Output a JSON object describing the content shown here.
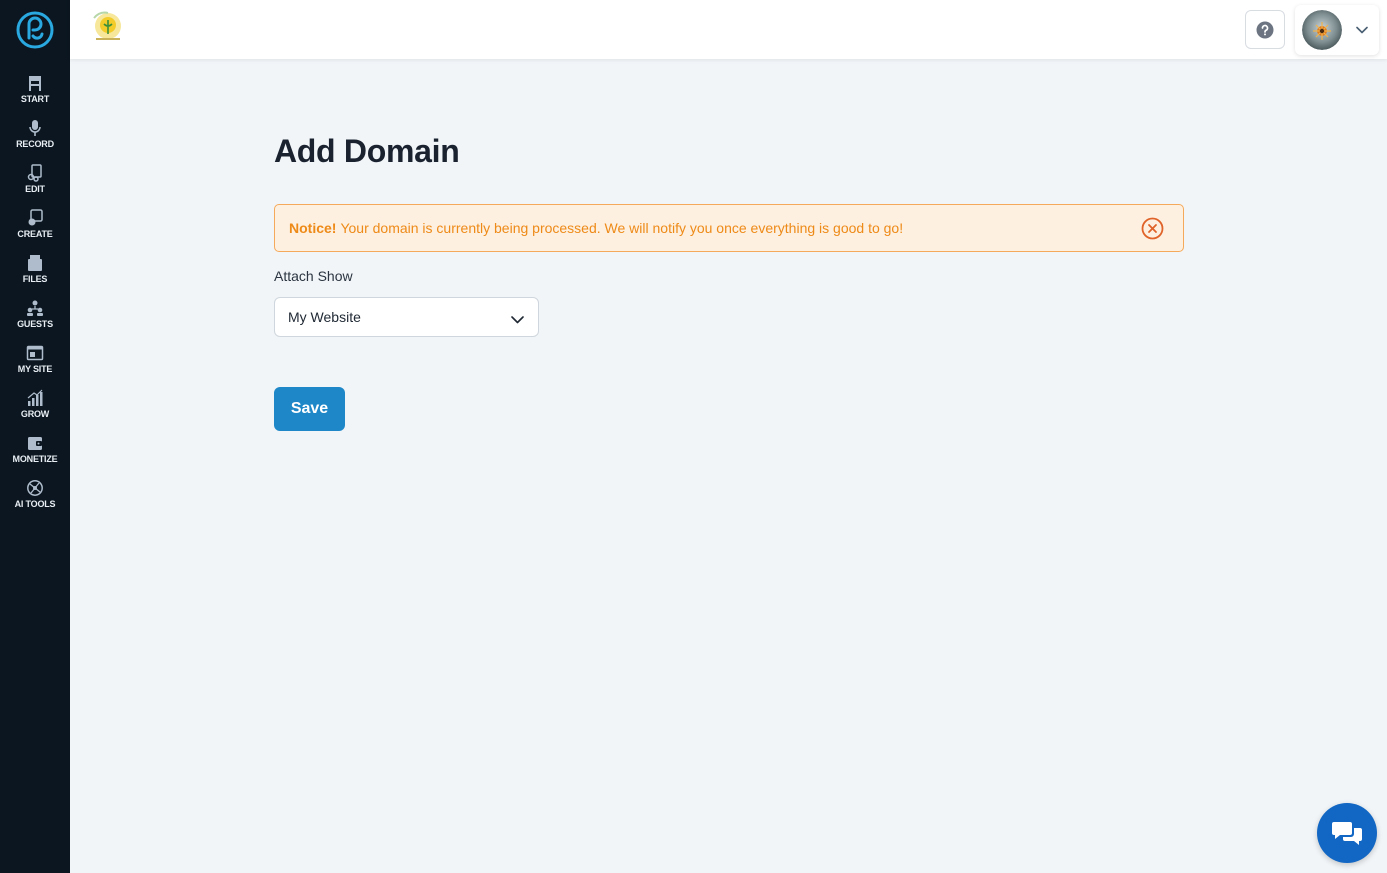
{
  "sidebar": {
    "items": [
      {
        "label": "START",
        "icon": "start-icon"
      },
      {
        "label": "RECORD",
        "icon": "microphone-icon"
      },
      {
        "label": "EDIT",
        "icon": "edit-icon"
      },
      {
        "label": "CREATE",
        "icon": "create-icon"
      },
      {
        "label": "FILES",
        "icon": "files-icon"
      },
      {
        "label": "GUESTS",
        "icon": "guests-icon"
      },
      {
        "label": "MY SITE",
        "icon": "my-site-icon"
      },
      {
        "label": "GROW",
        "icon": "grow-icon"
      },
      {
        "label": "MONETIZE",
        "icon": "monetize-icon"
      },
      {
        "label": "AI TOOLS",
        "icon": "ai-tools-icon"
      }
    ]
  },
  "header": {
    "help_icon": "question-circle-icon",
    "profile_chevron": "chevron-down-icon"
  },
  "main": {
    "title": "Add Domain",
    "notice": {
      "label": "Notice!",
      "message": "Your domain is currently being processed. We will notify you once everything is good to go!"
    },
    "attach_show": {
      "label": "Attach Show",
      "selected": "My Website"
    },
    "save_label": "Save"
  },
  "colors": {
    "sidebar_bg": "#0b1620",
    "accent": "#1e87c8",
    "notice_text": "#ee8a18",
    "notice_bg": "#fdf0e0",
    "chat_bg": "#1267c4"
  }
}
